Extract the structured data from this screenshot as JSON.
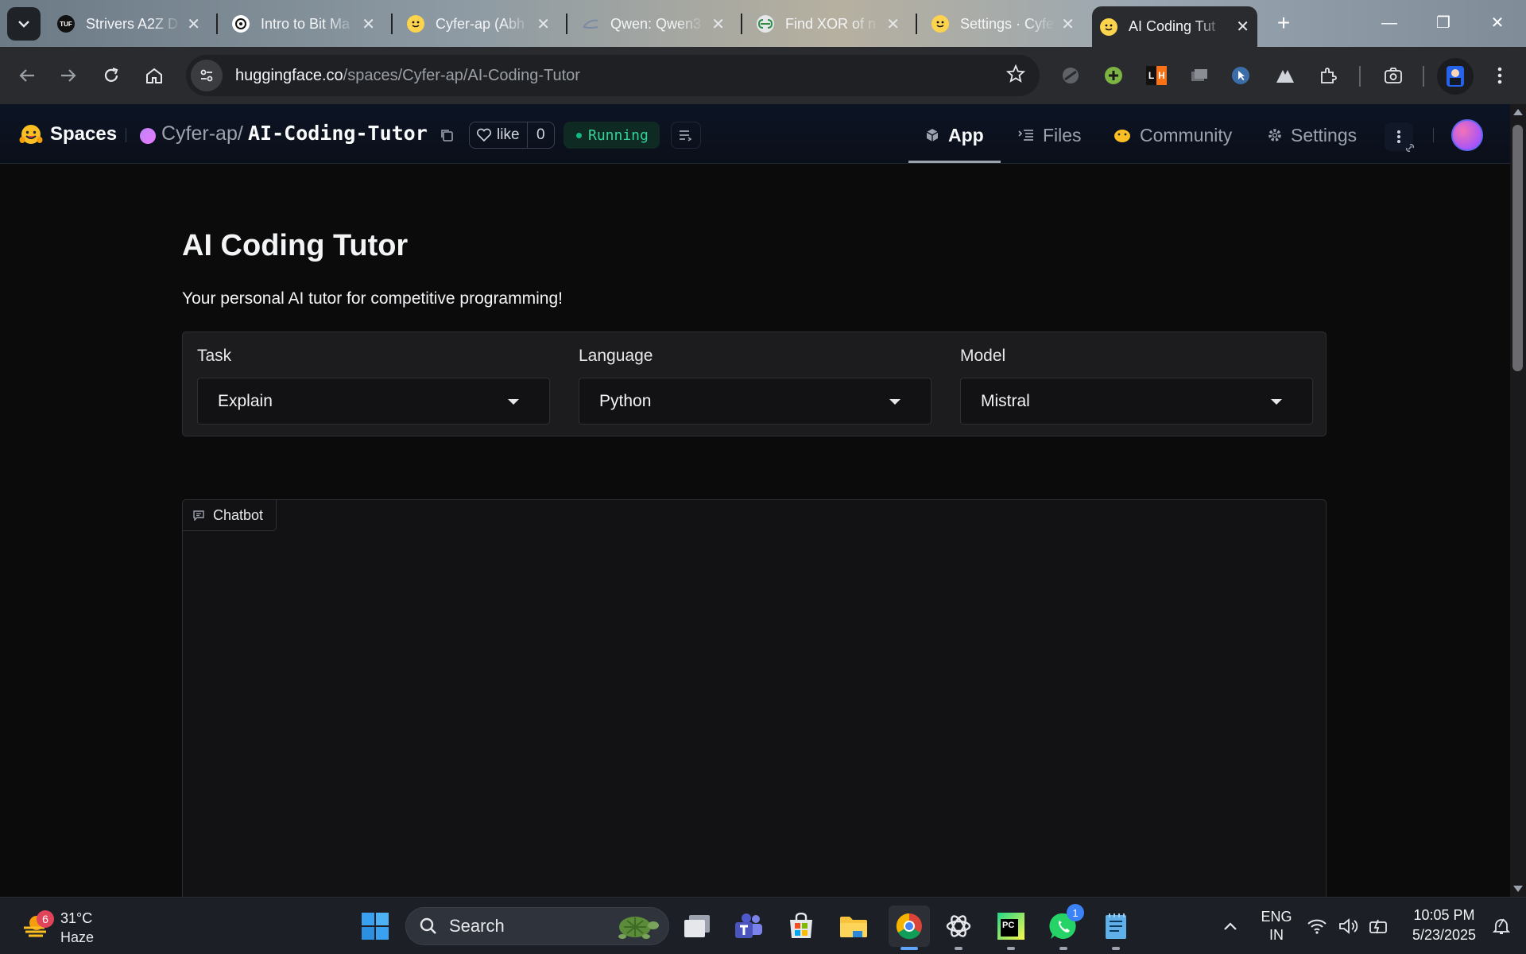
{
  "browser": {
    "tabs": [
      {
        "title": "Strivers A2Z D",
        "favicon": "tuf-icon"
      },
      {
        "title": "Intro to Bit Ma",
        "favicon": "openai-icon"
      },
      {
        "title": "Cyfer-ap (Abh",
        "favicon": "huggingface-icon"
      },
      {
        "title": "Qwen: Qwen3",
        "favicon": "openrouter-icon"
      },
      {
        "title": "Find XOR of n",
        "favicon": "gfg-icon"
      },
      {
        "title": "Settings · Cyfe",
        "favicon": "huggingface-icon"
      },
      {
        "title": "AI Coding Tut",
        "favicon": "huggingface-icon",
        "active": true
      }
    ],
    "tuf_label": "TUF",
    "url_host": "huggingface.co",
    "url_path": "/spaces/Cyfer-ap/AI-Coding-Tutor",
    "ext_lh_label": "LH"
  },
  "hf": {
    "brand": "Spaces",
    "owner": "Cyfer-ap",
    "slash": "/",
    "repo": "AI-Coding-Tutor",
    "like_label": "like",
    "like_count": "0",
    "status": "Running",
    "tabs": [
      "App",
      "Files",
      "Community",
      "Settings"
    ],
    "active_tab": "App"
  },
  "app": {
    "title": "AI Coding Tutor",
    "subtitle": "Your personal AI tutor for competitive programming!",
    "fields": [
      {
        "label": "Task",
        "value": "Explain"
      },
      {
        "label": "Language",
        "value": "Python"
      },
      {
        "label": "Model",
        "value": "Mistral"
      }
    ],
    "chatbot_label": "Chatbot"
  },
  "taskbar": {
    "weather_badge": "6",
    "temperature": "31°C",
    "condition": "Haze",
    "search_label": "Search",
    "whatsapp_badge": "1",
    "pycharm_label": "PC",
    "lang_top": "ENG",
    "lang_bottom": "IN",
    "time": "10:05 PM",
    "date": "5/23/2025"
  },
  "colors": {
    "accent": "#60a5fa",
    "running": "#34d399",
    "page_bg": "#0b0b0c",
    "header_bg": "#0b0f19"
  }
}
